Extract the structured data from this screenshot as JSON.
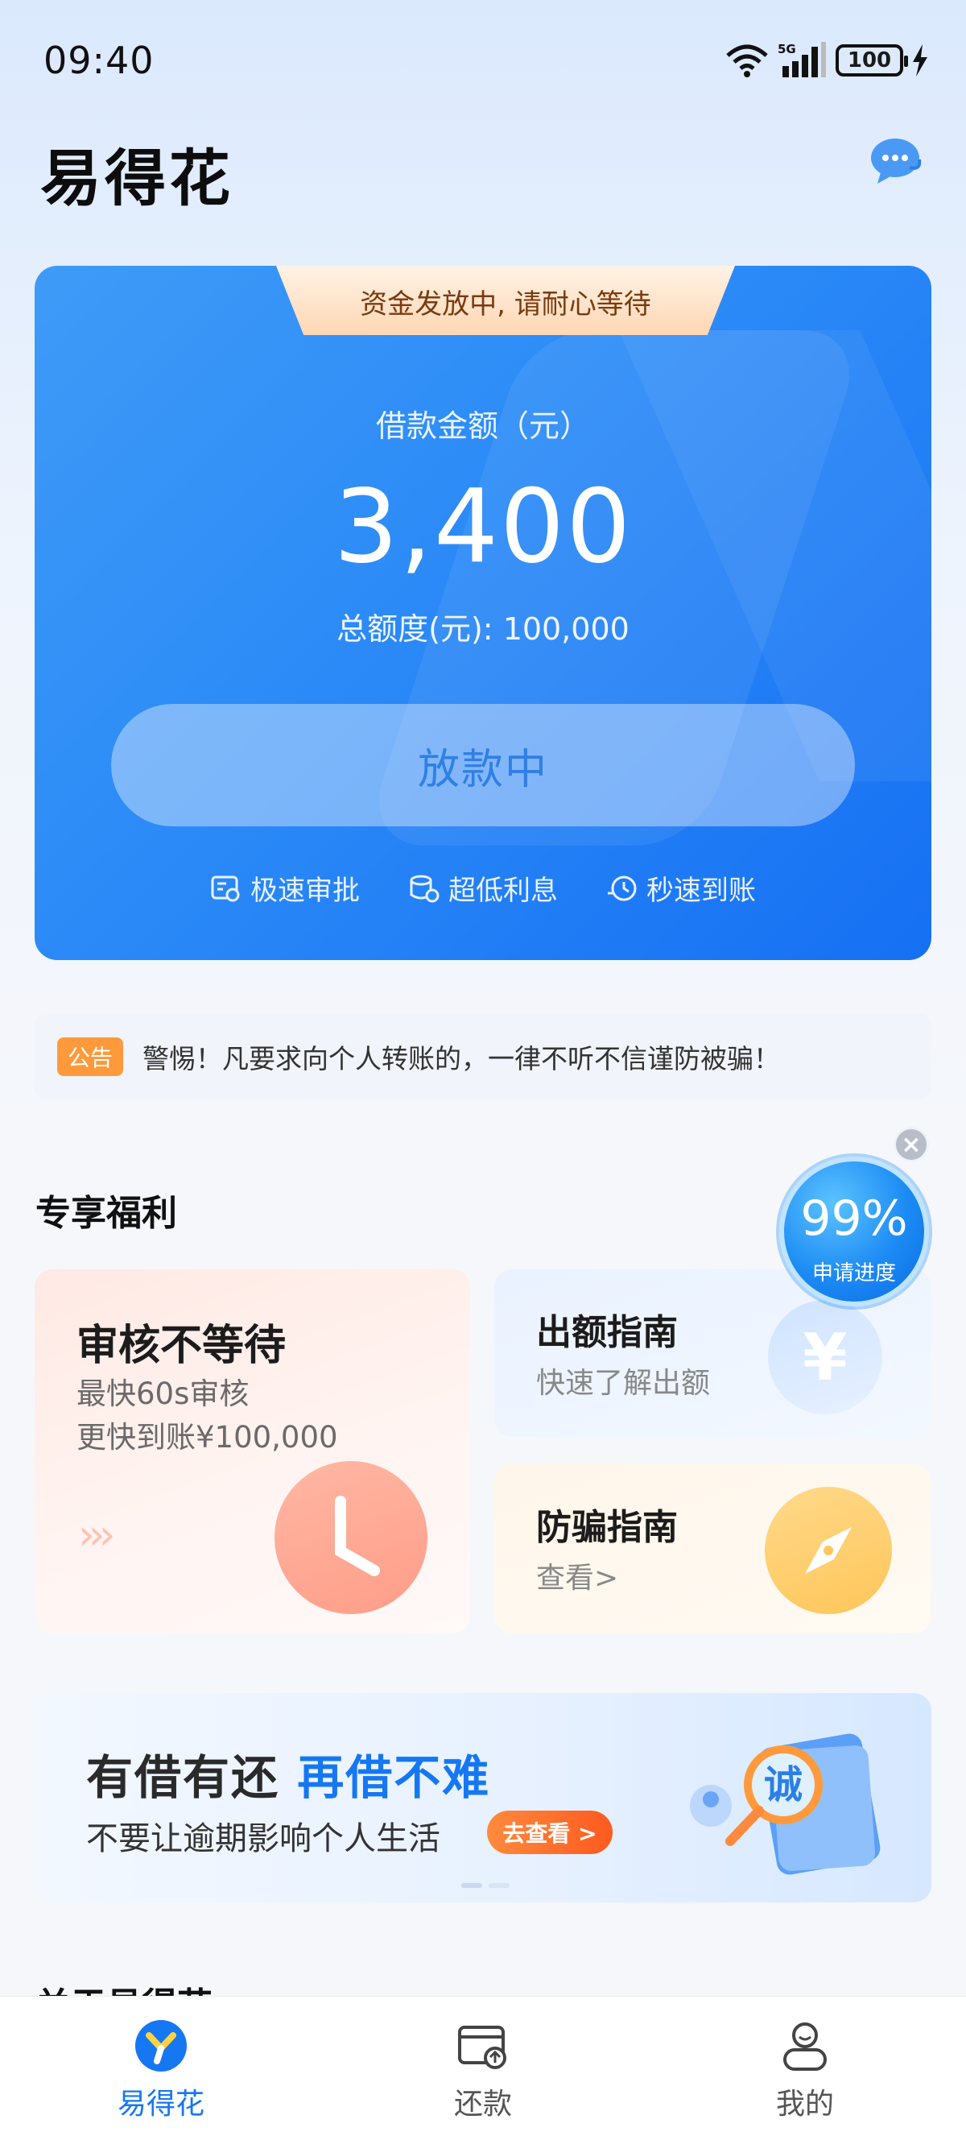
{
  "status_bar": {
    "time": "09:40",
    "network": "5G",
    "battery": "100"
  },
  "header": {
    "app_title": "易得花"
  },
  "loan_card": {
    "notice": "资金发放中, 请耐心等待",
    "amount_label": "借款金额（元）",
    "amount": "3,400",
    "total_limit": "总额度(元): 100,000",
    "status_button": "放款中",
    "features": [
      {
        "icon": "approval-icon",
        "label": "极速审批"
      },
      {
        "icon": "coins-icon",
        "label": "超低利息"
      },
      {
        "icon": "clock-fast-icon",
        "label": "秒速到账"
      }
    ]
  },
  "announcement": {
    "tag": "公告",
    "text": "警惕！凡要求向个人转账的，一律不听不信谨防被骗！"
  },
  "benefits": {
    "section_title": "专享福利",
    "progress": {
      "value": "99%",
      "label": "申请进度"
    },
    "card_review": {
      "title": "审核不等待",
      "line1": "最快60s审核",
      "line2": "更快到账¥100,000"
    },
    "card_quota": {
      "title": "出额指南",
      "subtitle": "快速了解出额"
    },
    "card_fraud": {
      "title": "防骗指南",
      "subtitle": "查看>"
    }
  },
  "banner": {
    "title_main": "有借有还 ",
    "title_accent": "再借不难",
    "subtitle": "不要让逾期影响个人生活",
    "button": "去查看 >",
    "art_char": "诚"
  },
  "about": {
    "title": "关于易得花"
  },
  "tabbar": {
    "items": [
      {
        "label": "易得花",
        "active": true
      },
      {
        "label": "还款",
        "active": false
      },
      {
        "label": "我的",
        "active": false
      }
    ]
  },
  "colors": {
    "accent": "#1677f2",
    "card_start": "#3f9bf7",
    "card_end": "#1670f3",
    "tag": "#ff9a3c"
  }
}
